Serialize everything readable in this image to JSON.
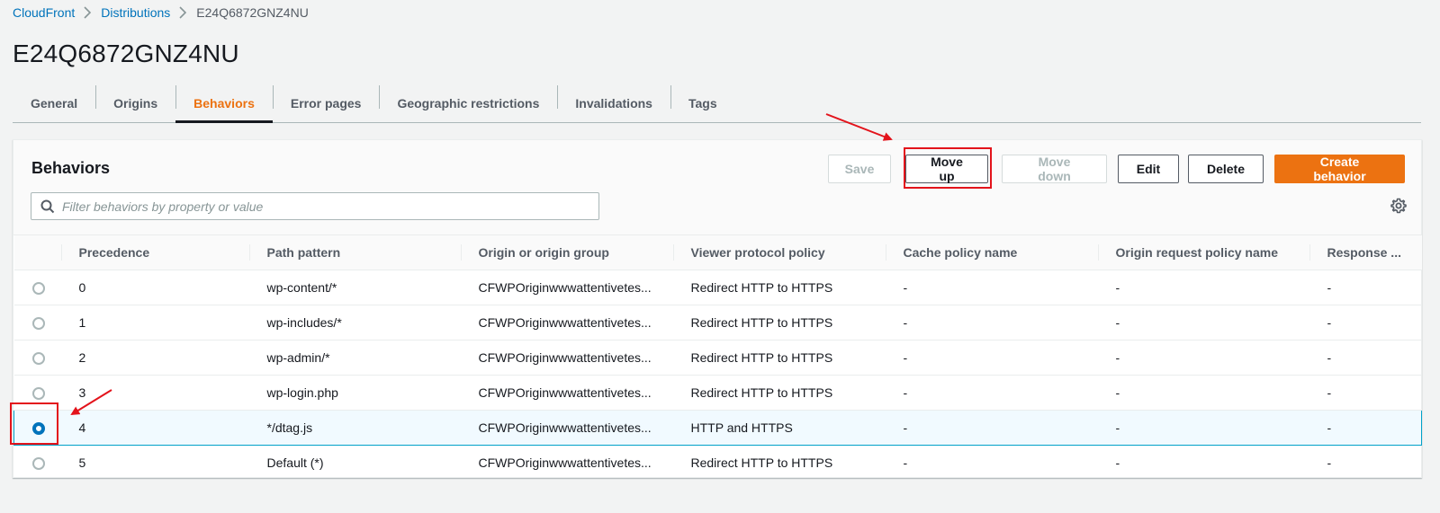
{
  "breadcrumb": {
    "items": [
      "CloudFront",
      "Distributions",
      "E24Q6872GNZ4NU"
    ]
  },
  "page_title": "E24Q6872GNZ4NU",
  "tabs": [
    "General",
    "Origins",
    "Behaviors",
    "Error pages",
    "Geographic restrictions",
    "Invalidations",
    "Tags"
  ],
  "active_tab": "Behaviors",
  "panel": {
    "title": "Behaviors",
    "buttons": {
      "save": "Save",
      "move_up": "Move up",
      "move_down": "Move down",
      "edit": "Edit",
      "delete": "Delete",
      "create": "Create behavior"
    },
    "search_placeholder": "Filter behaviors by property or value"
  },
  "table": {
    "columns": [
      "Precedence",
      "Path pattern",
      "Origin or origin group",
      "Viewer protocol policy",
      "Cache policy name",
      "Origin request policy name",
      "Response ..."
    ],
    "rows": [
      {
        "precedence": "0",
        "path": "wp-content/*",
        "origin": "CFWPOriginwwwattentivetes...",
        "viewer": "Redirect HTTP to HTTPS",
        "cache": "-",
        "origin_request": "-",
        "response": "-",
        "selected": false
      },
      {
        "precedence": "1",
        "path": "wp-includes/*",
        "origin": "CFWPOriginwwwattentivetes...",
        "viewer": "Redirect HTTP to HTTPS",
        "cache": "-",
        "origin_request": "-",
        "response": "-",
        "selected": false
      },
      {
        "precedence": "2",
        "path": "wp-admin/*",
        "origin": "CFWPOriginwwwattentivetes...",
        "viewer": "Redirect HTTP to HTTPS",
        "cache": "-",
        "origin_request": "-",
        "response": "-",
        "selected": false
      },
      {
        "precedence": "3",
        "path": "wp-login.php",
        "origin": "CFWPOriginwwwattentivetes...",
        "viewer": "Redirect HTTP to HTTPS",
        "cache": "-",
        "origin_request": "-",
        "response": "-",
        "selected": false
      },
      {
        "precedence": "4",
        "path": "*/dtag.js",
        "origin": "CFWPOriginwwwattentivetes...",
        "viewer": "HTTP and HTTPS",
        "cache": "-",
        "origin_request": "-",
        "response": "-",
        "selected": true
      },
      {
        "precedence": "5",
        "path": "Default (*)",
        "origin": "CFWPOriginwwwattentivetes...",
        "viewer": "Redirect HTTP to HTTPS",
        "cache": "-",
        "origin_request": "-",
        "response": "-",
        "selected": false
      }
    ]
  },
  "colors": {
    "accent_orange": "#ec7211",
    "link_blue": "#0073bb",
    "annotation_red": "#e3131b",
    "selected_row_border": "#00a1c9"
  },
  "icons": [
    "chevron-right-icon",
    "search-icon",
    "settings-gear-icon"
  ]
}
